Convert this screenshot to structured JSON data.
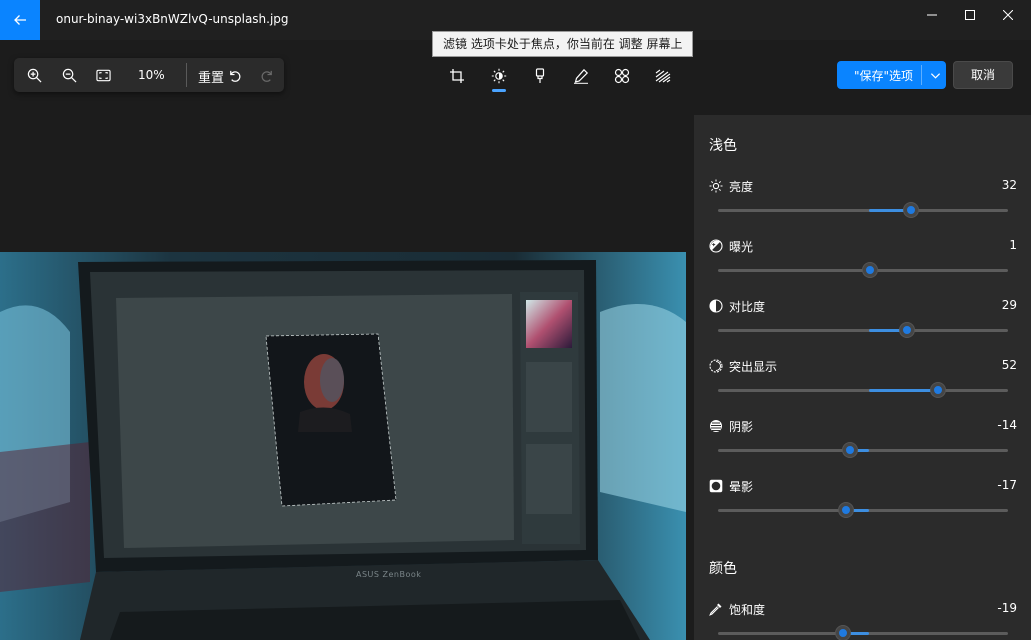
{
  "window": {
    "title": "onur-binay-wi3xBnWZlvQ-unsplash.jpg"
  },
  "tooltip": {
    "text": "滤镜 选项卡处于焦点，你当前在 调整 屏幕上"
  },
  "zoom_toolbar": {
    "zoom_level": "10%",
    "reset_label": "重置"
  },
  "tools": [
    "crop-icon",
    "adjust-icon",
    "filter-icon",
    "markup-icon",
    "red-eye-icon",
    "spot-fix-icon"
  ],
  "actions": {
    "save_label": "\"保存\"选项",
    "cancel_label": "取消"
  },
  "colors": {
    "accent": "#0a84ff",
    "panel_bg": "#2b2b2b",
    "app_bg": "#1c1c1c"
  },
  "panel": {
    "light_title": "浅色",
    "color_title": "颜色",
    "light": [
      {
        "label": "亮度",
        "value": "32",
        "level": 32
      },
      {
        "label": "曝光",
        "value": "1",
        "level": 1
      },
      {
        "label": "对比度",
        "value": "29",
        "level": 29
      },
      {
        "label": "突出显示",
        "value": "52",
        "level": 52
      },
      {
        "label": "阴影",
        "value": "-14",
        "level": -14
      },
      {
        "label": "晕影",
        "value": "-17",
        "level": -17
      }
    ],
    "color": [
      {
        "label": "饱和度",
        "value": "-19",
        "level": -19
      }
    ]
  },
  "photo": {
    "laptop_brand": "ASUS ZenBook"
  }
}
